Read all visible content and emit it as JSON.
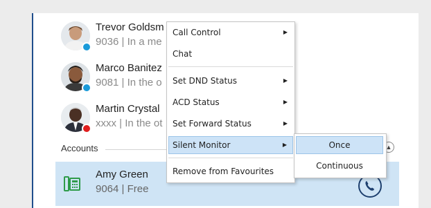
{
  "contacts": [
    {
      "name": "Trevor Goldsm",
      "detail": "9036 | In a me",
      "status": "available",
      "status_color": "#1a9ad9"
    },
    {
      "name": "Marco Banitez",
      "detail": "9081 | In the o",
      "status": "available",
      "status_color": "#1a9ad9"
    },
    {
      "name": "Martin Crystal",
      "detail": "xxxx | In the ot",
      "status": "busy",
      "status_color": "#e01e1e"
    }
  ],
  "accounts": {
    "label": "Accounts",
    "items": [
      {
        "name": "Amy Green",
        "detail": "9064 | Free"
      }
    ]
  },
  "context_menu": {
    "items": [
      {
        "label": "Call Control",
        "has_submenu": true
      },
      {
        "label": "Chat",
        "has_submenu": false
      },
      {
        "label": "Set DND Status",
        "has_submenu": true
      },
      {
        "label": "ACD Status",
        "has_submenu": true
      },
      {
        "label": "Set Forward Status",
        "has_submenu": true
      },
      {
        "label": "Silent Monitor",
        "has_submenu": true,
        "highlighted": true
      },
      {
        "label": "Remove from Favourites",
        "has_submenu": false
      }
    ],
    "submenu": {
      "parent": "Silent Monitor",
      "items": [
        {
          "label": "Once",
          "highlighted": true
        },
        {
          "label": "Continuous"
        }
      ]
    }
  },
  "colors": {
    "accent": "#1f4e8c",
    "highlight": "#cde3f7",
    "account_row_bg": "#cfe4f5",
    "account_icon": "#2e9b4a"
  }
}
